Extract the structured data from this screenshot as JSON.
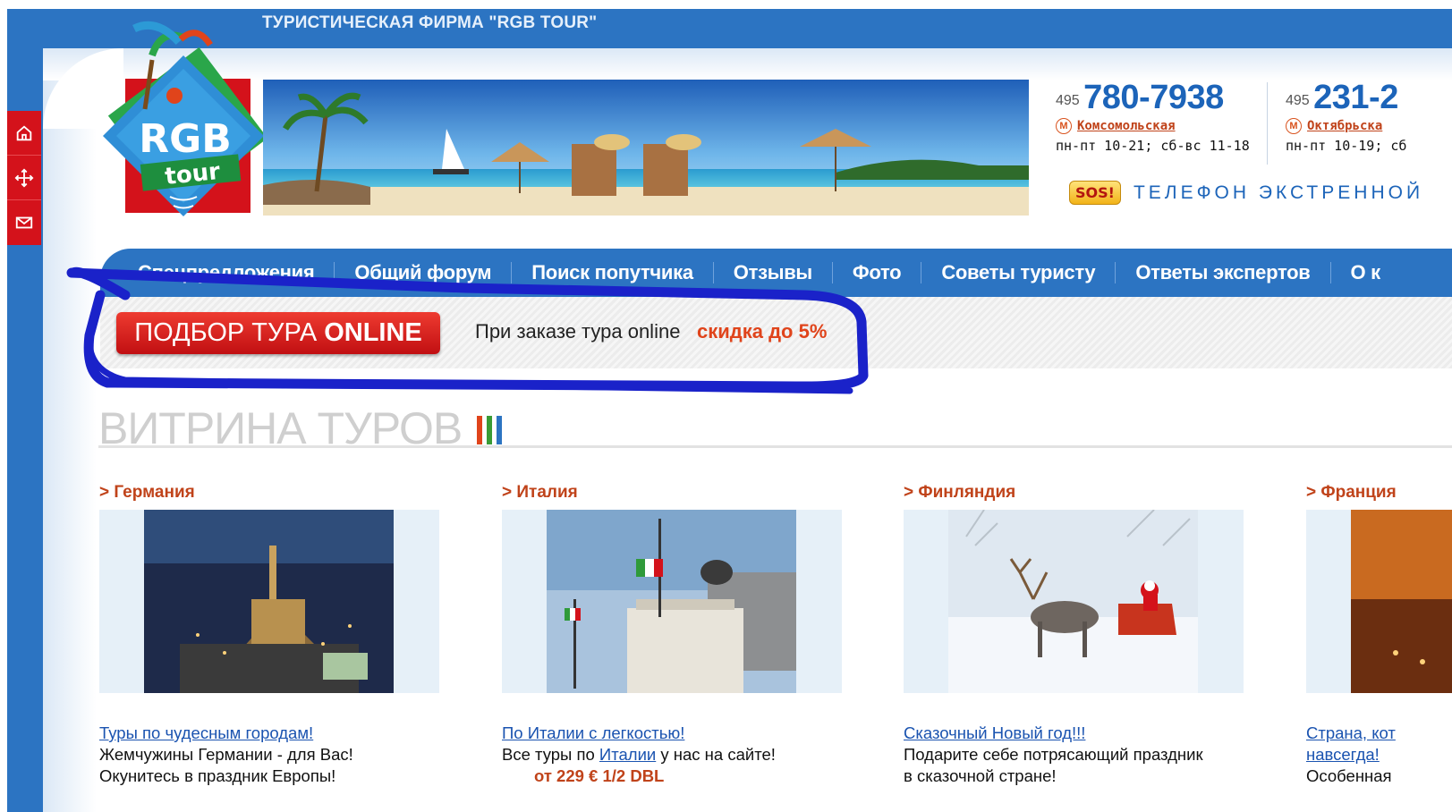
{
  "site": {
    "title": "ТУРИСТИЧЕСКАЯ ФИРМА \"RGB TOUR\"",
    "logo_text_top": "RGB",
    "logo_text_bottom": "tour"
  },
  "side_tools": [
    {
      "icon": "home-icon"
    },
    {
      "icon": "move-icon"
    },
    {
      "icon": "mail-icon"
    }
  ],
  "phones": [
    {
      "code": "495",
      "number": "780-7938",
      "metro": "Комсомольская",
      "hours": "пн-пт 10-21; сб-вс 11-18"
    },
    {
      "code": "495",
      "number": "231-2",
      "metro": "Октябрьска",
      "hours": "пн-пт 10-19; сб"
    }
  ],
  "emergency": {
    "badge": "SOS!",
    "text": "ТЕЛЕФОН ЭКСТРЕННОЙ"
  },
  "nav": [
    "Спецпредложения",
    "Общий форум",
    "Поиск попутчика",
    "Отзывы",
    "Фото",
    "Советы туристу",
    "Ответы экспертов",
    "О к"
  ],
  "promo": {
    "button_plain": "ПОДБОР ТУРА",
    "button_bold": "ONLINE",
    "text": "При заказе тура online",
    "highlight": "скидка до 5%"
  },
  "showcase": {
    "title": "ВИТРИНА ТУРОВ",
    "bar_colors": [
      "#e0441b",
      "#3a9b35",
      "#2c74c2"
    ]
  },
  "cards": [
    {
      "country": "> Германия",
      "link": "Туры по чудесным городам!",
      "desc_plain": "Жемчужины Германии - для Вас!",
      "desc_link": "",
      "desc_after": "",
      "more": "Окунитесь в праздник Европы!"
    },
    {
      "country": "> Италия",
      "link": "По Италии с легкостью!",
      "desc_plain": "Все туры по ",
      "desc_link": "Италии",
      "desc_after": " у нас на сайте!",
      "more": "от 229 € 1/2 DBL"
    },
    {
      "country": "> Финляндия",
      "link": "Сказочный Новый год!!!",
      "desc_plain": "Подарите себе потрясающий праздник",
      "desc_link": "",
      "desc_after": "",
      "more": "в сказочной стране!"
    },
    {
      "country": "> Франция",
      "link": "Страна, кот",
      "desc_plain": "",
      "desc_link": "навсегда!",
      "desc_after": "",
      "more": "Особенная"
    }
  ]
}
